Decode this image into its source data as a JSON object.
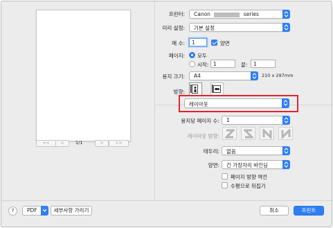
{
  "printer": {
    "label": "프린터:",
    "value_prefix": "Canon",
    "value_suffix": "series"
  },
  "presets": {
    "label": "미리 설정:",
    "value": "기본 설정"
  },
  "copies": {
    "label": "매 수:",
    "value": "1",
    "duplex_label": "양면",
    "duplex_checked": true
  },
  "pages": {
    "label": "페이지:",
    "all_label": "모두",
    "from_label": "시작:",
    "from_value": "1",
    "to_label": "끝:",
    "to_value": "1"
  },
  "paper_size": {
    "label": "용지 크기:",
    "value": "A4",
    "dimensions": "210 x 297mm"
  },
  "orientation": {
    "label": "방향:"
  },
  "section": {
    "value": "레이아웃"
  },
  "pages_per_sheet": {
    "label": "용지당 페이지 수:",
    "value": "1"
  },
  "layout_direction": {
    "label": "레이아웃 방향:"
  },
  "border": {
    "label": "테두리:",
    "value": "없음"
  },
  "two_sided": {
    "label": "양면:",
    "value": "긴 가장자리 바인딩"
  },
  "reverse_orientation": {
    "label": "페이지 방향 역전"
  },
  "flip_horizontal": {
    "label": "수평으로 뒤집기"
  },
  "preview": {
    "first": "<<",
    "prev": "<",
    "page_indicator": "1/1",
    "next": ">",
    "last": ">>"
  },
  "footer": {
    "help": "?",
    "pdf": "PDF",
    "hide_details": "세부사항 가리기",
    "cancel": "취소",
    "print": "프린트"
  },
  "colors": {
    "accent": "#2f7ef6",
    "highlight_box": "#e0242a"
  }
}
